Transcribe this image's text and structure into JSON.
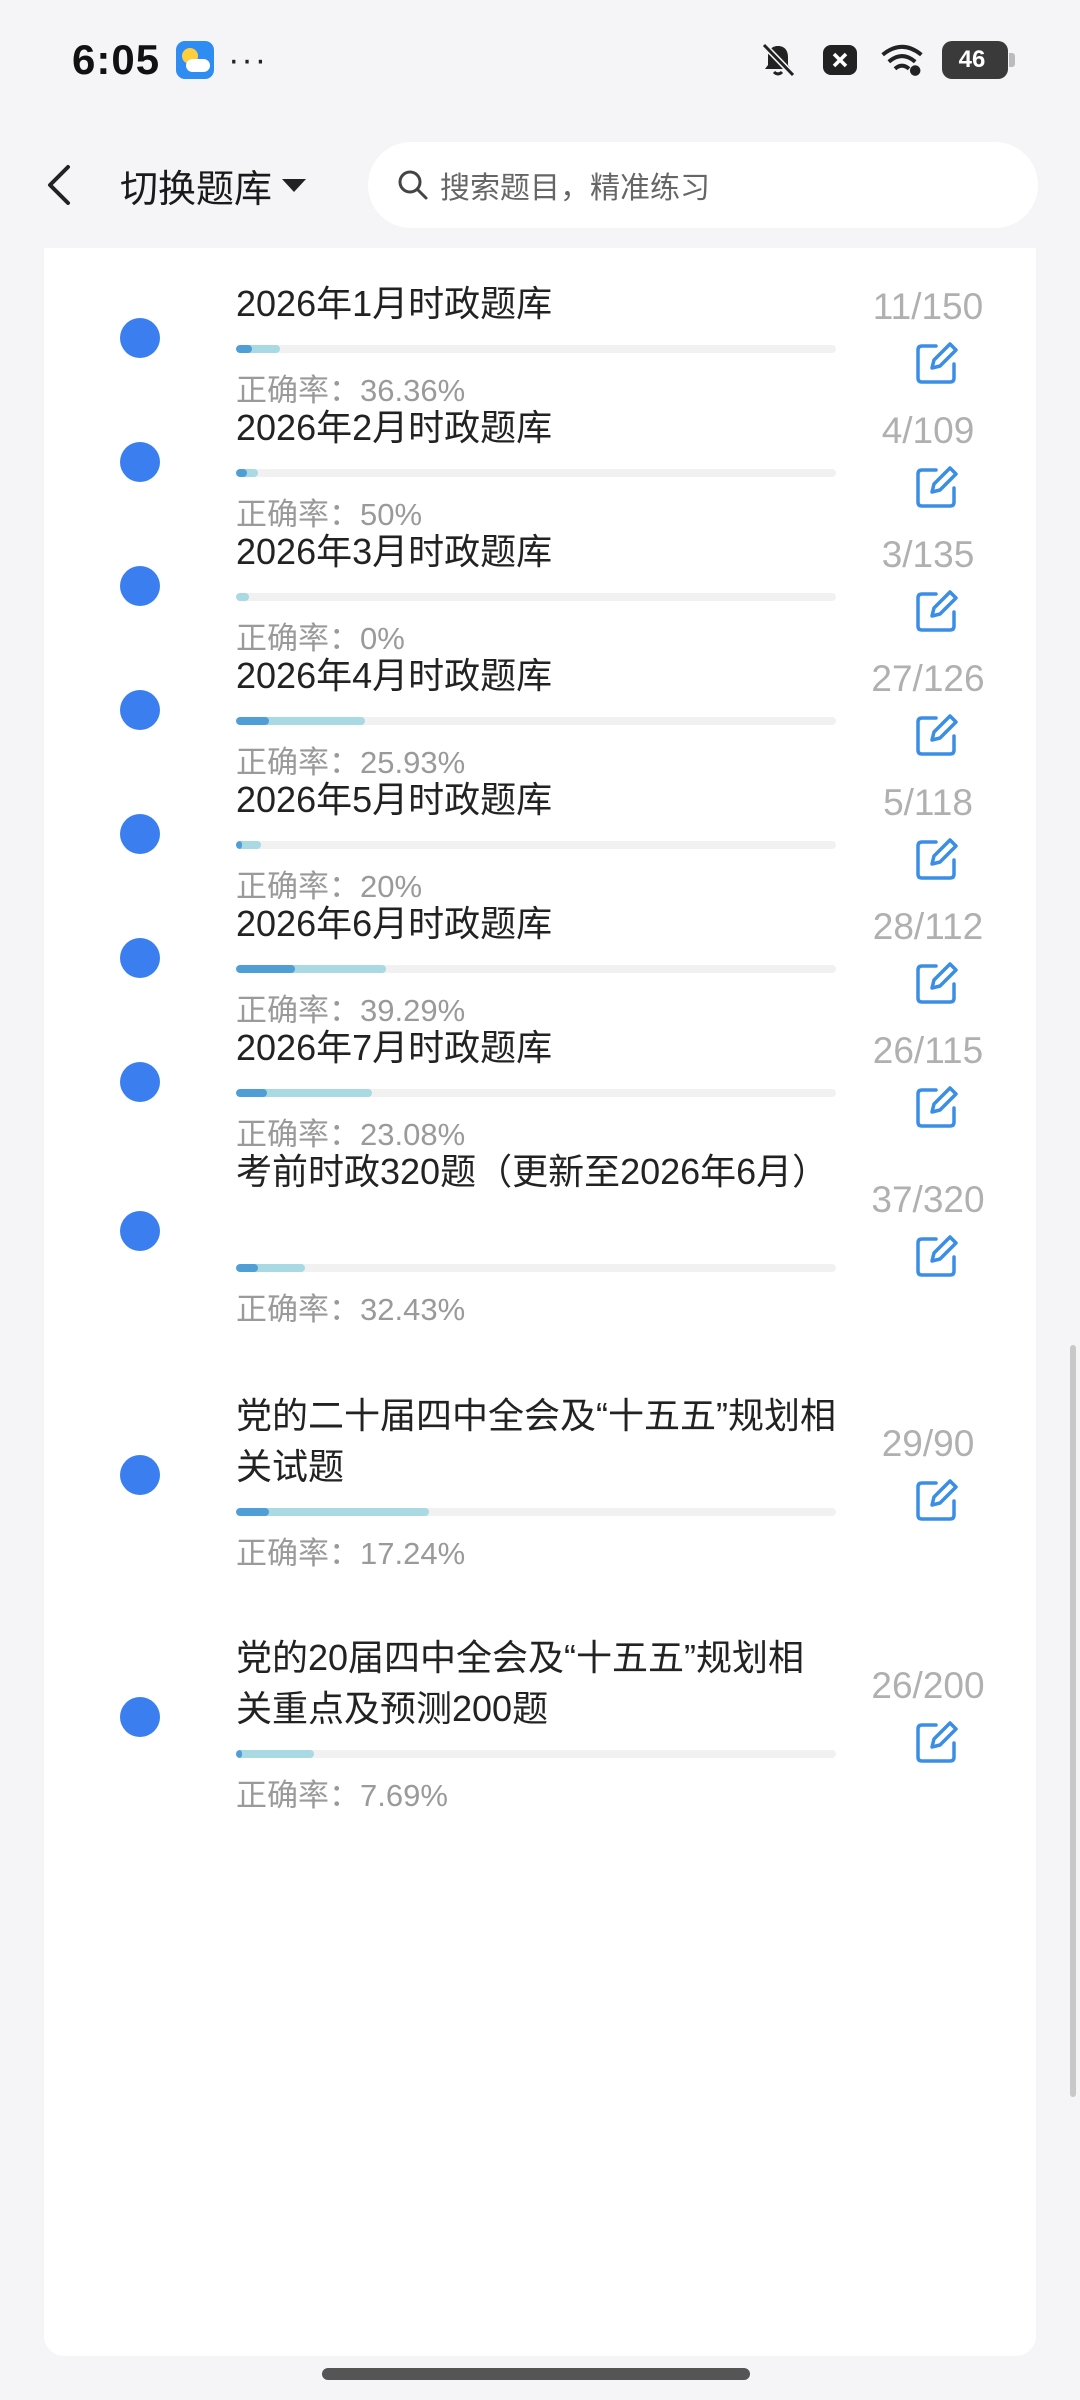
{
  "status_bar": {
    "time": "6:05",
    "dots": "···",
    "battery": "46"
  },
  "header": {
    "switch_label": "切换题库",
    "search_placeholder": "搜索题目，精准练习"
  },
  "items": [
    {
      "title": "2026年1月时政题库",
      "accuracy": "正确率：36.36%",
      "count": "11/150",
      "done": 11,
      "total": 150,
      "correct_ratio": 0.3636
    },
    {
      "title": "2026年2月时政题库",
      "accuracy": "正确率：50%",
      "count": "4/109",
      "done": 4,
      "total": 109,
      "correct_ratio": 0.5
    },
    {
      "title": "2026年3月时政题库",
      "accuracy": "正确率：0%",
      "count": "3/135",
      "done": 3,
      "total": 135,
      "correct_ratio": 0
    },
    {
      "title": "2026年4月时政题库",
      "accuracy": "正确率：25.93%",
      "count": "27/126",
      "done": 27,
      "total": 126,
      "correct_ratio": 0.2593
    },
    {
      "title": "2026年5月时政题库",
      "accuracy": "正确率：20%",
      "count": "5/118",
      "done": 5,
      "total": 118,
      "correct_ratio": 0.2
    },
    {
      "title": "2026年6月时政题库",
      "accuracy": "正确率：39.29%",
      "count": "28/112",
      "done": 28,
      "total": 112,
      "correct_ratio": 0.3929
    },
    {
      "title": "2026年7月时政题库",
      "accuracy": "正确率：23.08%",
      "count": "26/115",
      "done": 26,
      "total": 115,
      "correct_ratio": 0.2308
    },
    {
      "title": "考前时政320题（更新至2026年6月）",
      "accuracy": "正确率：32.43%",
      "count": "37/320",
      "done": 37,
      "total": 320,
      "correct_ratio": 0.3243
    },
    {
      "title": "党的二十届四中全会及“十五五”规划相关试题",
      "accuracy": "正确率：17.24%",
      "count": "29/90",
      "done": 29,
      "total": 90,
      "correct_ratio": 0.1724
    },
    {
      "title": "党的20届四中全会及“十五五”规划相关重点及预测200题",
      "accuracy": "正确率：7.69%",
      "count": "26/200",
      "done": 26,
      "total": 200,
      "correct_ratio": 0.0769
    }
  ],
  "colors": {
    "dot": "#3a7ef0",
    "progress_correct": "#4f9fd6",
    "progress_done": "#a9d9e2",
    "edit_icon": "#3a8ee6"
  }
}
